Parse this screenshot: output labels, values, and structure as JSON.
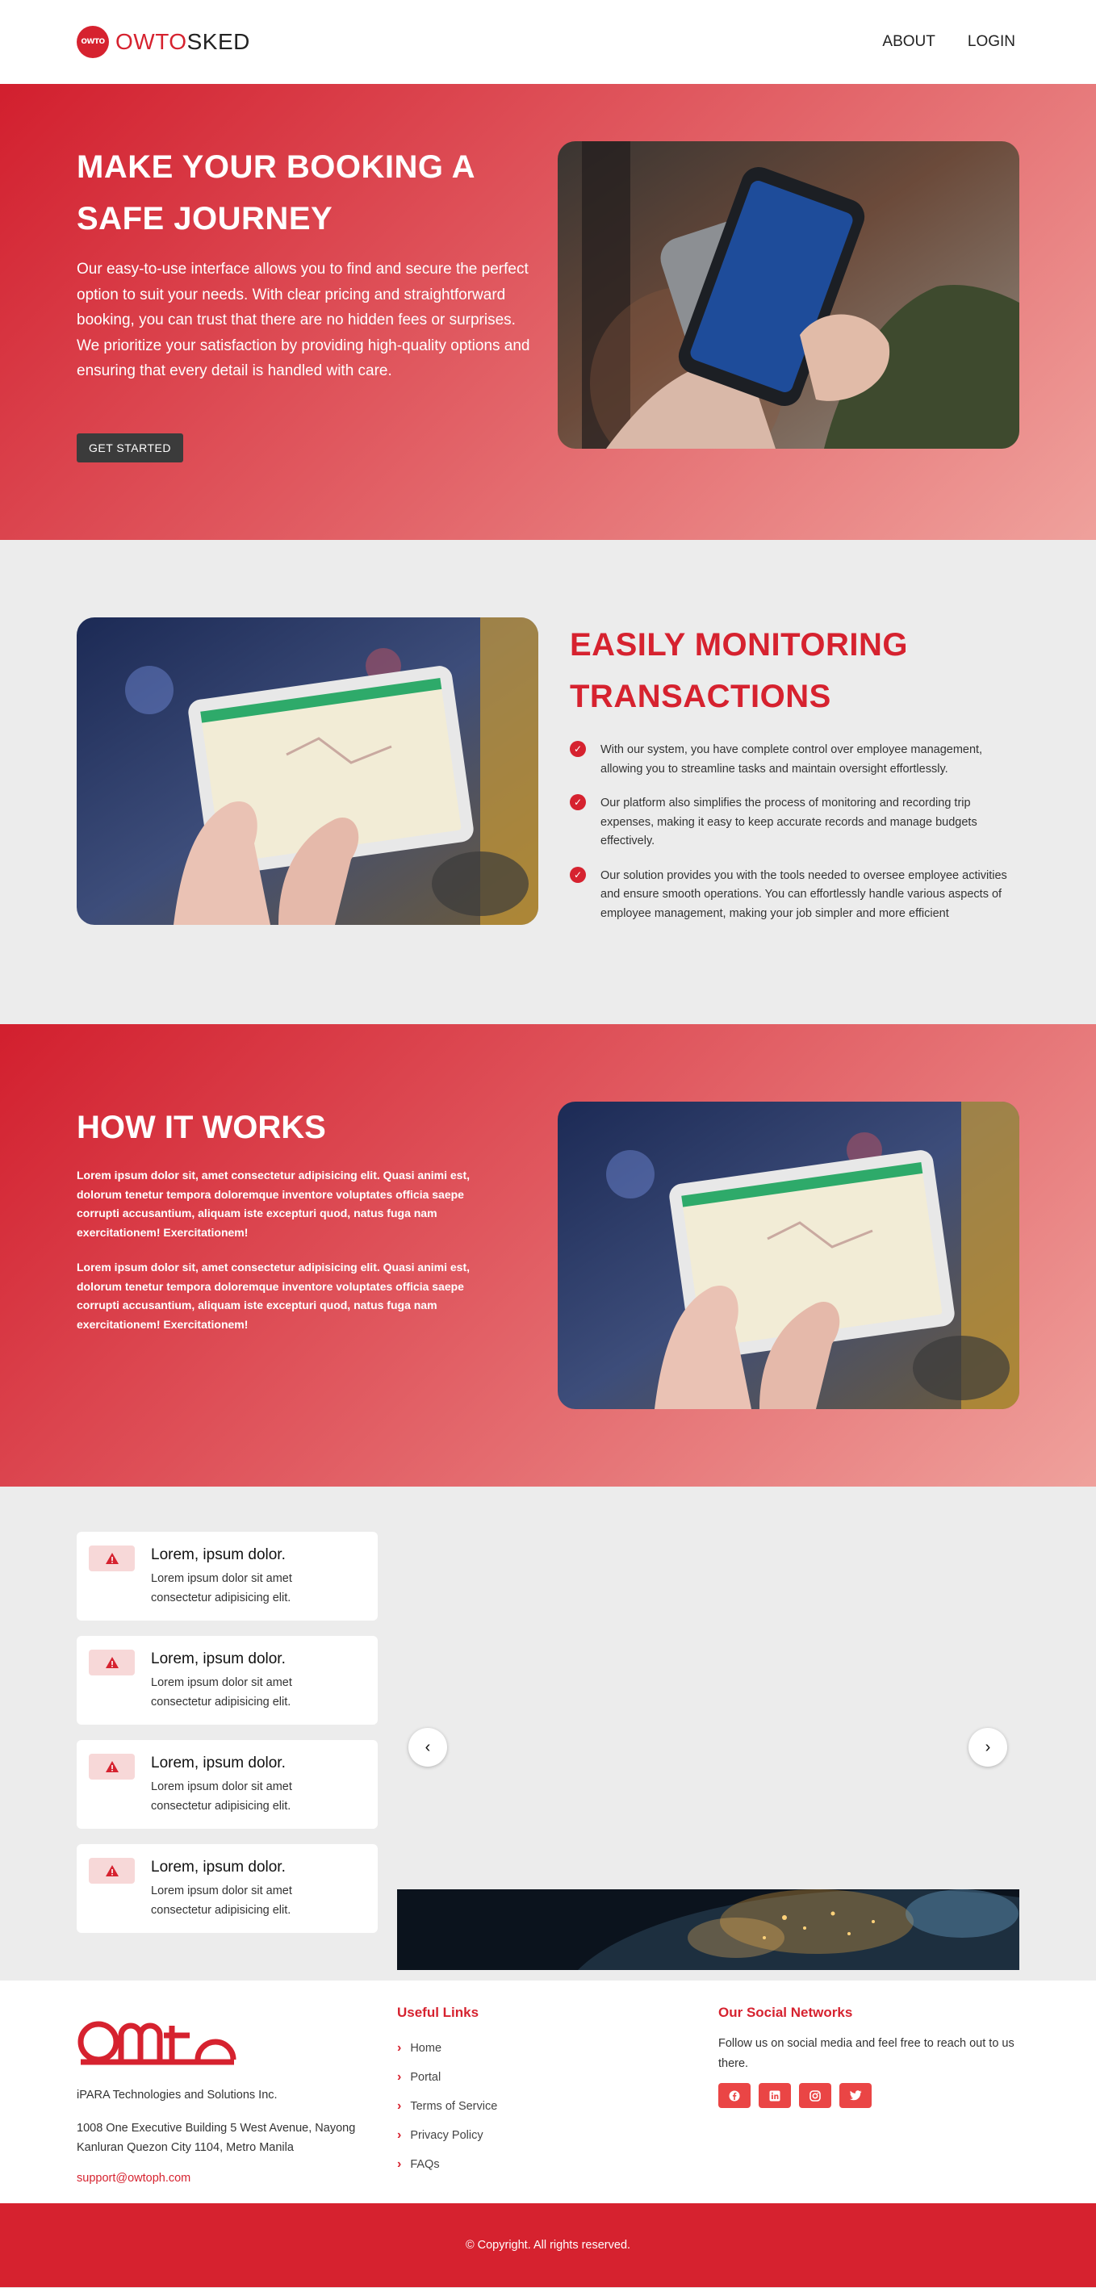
{
  "header": {
    "logo_badge": "OWTO",
    "brand_red": "OWTO",
    "brand_dark": "SKED",
    "nav": [
      "ABOUT",
      "LOGIN"
    ]
  },
  "hero": {
    "title": "MAKE YOUR BOOKING A SAFE JOURNEY",
    "text": "Our easy-to-use interface allows you to find and secure the perfect option to suit your needs. With clear pricing and straightforward booking, you can trust that there are no hidden fees or surprises. We prioritize your satisfaction by providing high-quality options and ensuring that every detail is handled with care.",
    "button": "GET STARTED"
  },
  "monitor": {
    "title": "EASILY MONITORING TRANSACTIONS",
    "items": [
      "With our system, you have complete control over employee management, allowing you to streamline tasks and maintain oversight effortlessly.",
      "Our platform also simplifies the process of monitoring and recording trip expenses, making it easy to keep accurate records and manage budgets effectively.",
      "Our solution provides you with the tools needed to oversee employee activities and ensure smooth operations. You can effortlessly handle various aspects of employee management, making your job simpler and more efficient"
    ]
  },
  "how": {
    "title": "HOW IT WORKS",
    "paragraphs": [
      "Lorem ipsum dolor sit, amet consectetur adipisicing elit. Quasi animi est, dolorum tenetur tempora doloremque inventore voluptates officia saepe corrupti accusantium, aliquam iste excepturi quod, natus fuga nam exercitationem! Exercitationem!",
      "Lorem ipsum dolor sit, amet consectetur adipisicing elit. Quasi animi est, dolorum tenetur tempora doloremque inventore voluptates officia saepe corrupti accusantium, aliquam iste excepturi quod, natus fuga nam exercitationem! Exercitationem!"
    ]
  },
  "features": {
    "cards": [
      {
        "title": "Lorem, ipsum dolor.",
        "text": "Lorem ipsum dolor sit amet consectetur adipisicing elit."
      },
      {
        "title": "Lorem, ipsum dolor.",
        "text": "Lorem ipsum dolor sit amet consectetur adipisicing elit."
      },
      {
        "title": "Lorem, ipsum dolor.",
        "text": "Lorem ipsum dolor sit amet consectetur adipisicing elit."
      },
      {
        "title": "Lorem, ipsum dolor.",
        "text": "Lorem ipsum dolor sit amet consectetur adipisicing elit."
      }
    ],
    "carousel_prev": "‹",
    "carousel_next": "›"
  },
  "footer": {
    "company": "iPARA Technologies and Solutions Inc.",
    "address": "1008 One Executive Building 5 West Avenue, Nayong Kanluran Quezon City 1104, Metro Manila",
    "email": "support@owtoph.com",
    "links_title": "Useful Links",
    "links": [
      "Home",
      "Portal",
      "Terms of Service",
      "Privacy Policy",
      "FAQs"
    ],
    "social_title": "Our Social Networks",
    "social_text": "Follow us on social media and feel free to reach out to us there.",
    "social_icons": [
      "facebook-icon",
      "linkedin-icon",
      "instagram-icon",
      "twitter-icon"
    ]
  },
  "copyright": "© Copyright. All rights reserved.",
  "colors": {
    "brand_red": "#d6222f",
    "gradient_light": "#efa19c",
    "button_dark": "#3b3b3b",
    "section_gray": "#ececec"
  }
}
